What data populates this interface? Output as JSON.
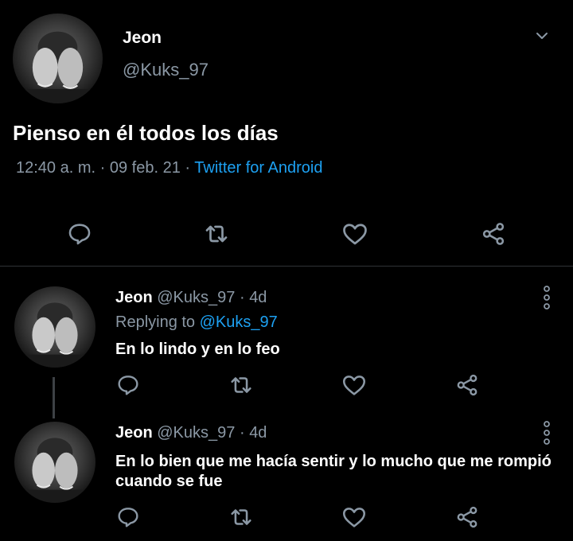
{
  "main_tweet": {
    "author_name": "Jeon",
    "author_handle": "@Kuks_97",
    "text": "Pienso en él todos los días",
    "time": "12:40 a. m.",
    "date": "09 feb. 21",
    "source": "Twitter for Android",
    "separator": "·"
  },
  "replies": [
    {
      "author_name": "Jeon",
      "author_handle": "@Kuks_97",
      "age": "4d",
      "separator": "·",
      "replying_label": "Replying to",
      "replying_handle": "@Kuks_97",
      "text": "En lo lindo y en lo feo"
    },
    {
      "author_name": "Jeon",
      "author_handle": "@Kuks_97",
      "age": "4d",
      "separator": "·",
      "text_line1": "En lo bien que me hacía sentir y lo mucho que me rompió",
      "text_line2": "cuando se fue"
    }
  ],
  "icons": {
    "reply": "reply-icon",
    "retweet": "retweet-icon",
    "like": "heart-icon",
    "share": "share-icon",
    "more": "more-vertical-icon",
    "caret": "chevron-down-icon"
  },
  "colors": {
    "background": "#000000",
    "text": "#ffffff",
    "muted": "#8b98a5",
    "link": "#1da1f2",
    "icon": "#8b98a5",
    "divider": "#2f3336"
  }
}
